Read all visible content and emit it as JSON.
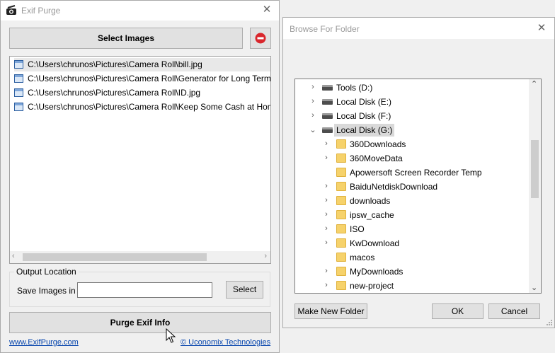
{
  "exif_window": {
    "title": "Exif Purge",
    "select_images_label": "Select Images",
    "files": [
      "C:\\Users\\chrunos\\Pictures\\Camera Roll\\bill.jpg",
      "C:\\Users\\chrunos\\Pictures\\Camera Roll\\Generator for Long Term",
      "C:\\Users\\chrunos\\Pictures\\Camera Roll\\ID.jpg",
      "C:\\Users\\chrunos\\Pictures\\Camera Roll\\Keep Some Cash at Hom"
    ],
    "output_location_label": "Output Location",
    "save_images_label": "Save Images in",
    "save_path_value": "",
    "select_label": "Select",
    "purge_label": "Purge Exif Info",
    "site_link": "www.ExifPurge.com",
    "company_link": "© Uconomix Technologies"
  },
  "browse_dialog": {
    "title": "Browse For Folder",
    "tree": [
      {
        "label": "Tools (D:)",
        "type": "drive",
        "expand": "collapsed"
      },
      {
        "label": "Local Disk (E:)",
        "type": "drive",
        "expand": "collapsed"
      },
      {
        "label": "Local Disk (F:)",
        "type": "drive",
        "expand": "collapsed"
      },
      {
        "label": "Local Disk (G:)",
        "type": "drive",
        "expand": "expanded",
        "selected": true
      },
      {
        "label": "360Downloads",
        "type": "folder",
        "expand": "collapsed"
      },
      {
        "label": "360MoveData",
        "type": "folder",
        "expand": "collapsed"
      },
      {
        "label": "Apowersoft Screen Recorder Temp",
        "type": "folder",
        "expand": "none"
      },
      {
        "label": "BaiduNetdiskDownload",
        "type": "folder",
        "expand": "collapsed"
      },
      {
        "label": "downloads",
        "type": "folder",
        "expand": "collapsed"
      },
      {
        "label": "ipsw_cache",
        "type": "folder",
        "expand": "collapsed"
      },
      {
        "label": "ISO",
        "type": "folder",
        "expand": "collapsed"
      },
      {
        "label": "KwDownload",
        "type": "folder",
        "expand": "collapsed"
      },
      {
        "label": "macos",
        "type": "folder",
        "expand": "none"
      },
      {
        "label": "MyDownloads",
        "type": "folder",
        "expand": "collapsed"
      },
      {
        "label": "new-project",
        "type": "folder",
        "expand": "collapsed"
      }
    ],
    "make_new_folder_label": "Make New Folder",
    "ok_label": "OK",
    "cancel_label": "Cancel"
  },
  "colors": {
    "remove_button_red": "#d9262c",
    "link_blue": "#0645ad",
    "selected_row_bg": "#d9d9d9"
  }
}
